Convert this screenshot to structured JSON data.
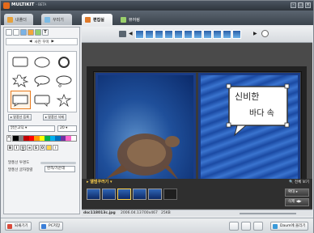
{
  "app": {
    "title": "MULTIKIT",
    "subtitle": "- BETA"
  },
  "tabs": [
    {
      "label": "내폴더"
    },
    {
      "label": "꾸미기"
    },
    {
      "label": "편집실"
    },
    {
      "label": "뷰어링"
    }
  ],
  "left_panel": {
    "section_title": "사진 꾸미",
    "buttons": {
      "speech_add": "말풍선 등록",
      "speech_delete": "말풍선 삭제"
    },
    "font_select": "맑은고딕 ▾",
    "font_size": "20",
    "opacity_label": "말풍선 투명도",
    "text_align_label": "말풍선 글자정렬",
    "text_align_value": "왼쪽/가운데"
  },
  "canvas": {
    "speech_text_line1": "신비한",
    "speech_text_line2": "바다 속"
  },
  "album": {
    "title": "앨범꾸러기",
    "view_all": "전체 보기",
    "side_buttons": [
      "확대",
      "삭제"
    ]
  },
  "status": {
    "filename": "dsc118013c.jpg",
    "date": "2006.04.13",
    "dimensions": "700x467",
    "size": "25KB"
  },
  "bottom": {
    "btn1": "되새기기",
    "btn2": "PC저장",
    "btn3": "Daum에 올리기"
  }
}
